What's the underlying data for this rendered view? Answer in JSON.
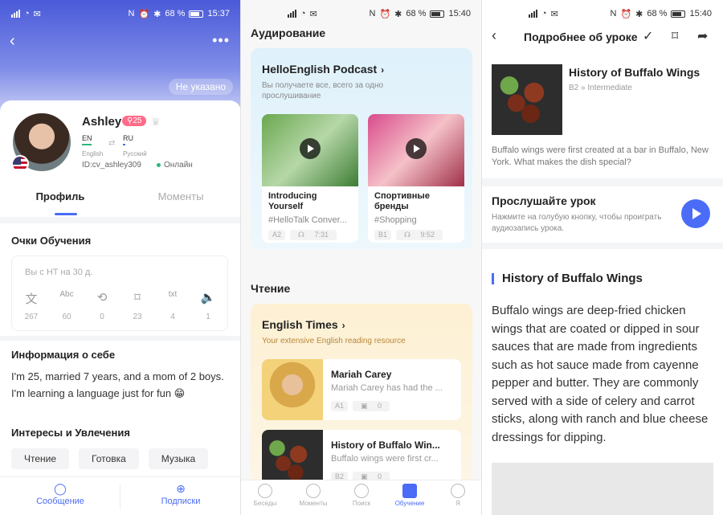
{
  "status_bars": [
    {
      "battery": "68 %",
      "time": "15:37"
    },
    {
      "battery": "68 %",
      "time": "15:40"
    },
    {
      "battery": "68 %",
      "time": "15:40"
    }
  ],
  "profile": {
    "not_specified": "Не указано",
    "name": "Ashley",
    "level": "25",
    "native_lang": {
      "code": "EN",
      "name": "English"
    },
    "learning_lang": {
      "code": "RU",
      "name": "Русский"
    },
    "user_id": "ID:cv_ashley309",
    "online": "Онлайн",
    "tabs": [
      "Профиль",
      "Моменты"
    ],
    "points": {
      "title": "Очки Обучения",
      "hint": "Вы с HT на 30 д.",
      "stats": [
        {
          "icon": "translate-icon",
          "glyph": "文",
          "value": "267"
        },
        {
          "icon": "correct-icon",
          "glyph": "Abc",
          "value": "60"
        },
        {
          "icon": "repeat-icon",
          "glyph": "⟲",
          "value": "0"
        },
        {
          "icon": "bookmark-icon",
          "glyph": "⌑",
          "value": "23"
        },
        {
          "icon": "transcribe-icon",
          "glyph": "txt",
          "value": "4"
        },
        {
          "icon": "speaker-icon",
          "glyph": "🔈",
          "value": "1"
        }
      ]
    },
    "about": {
      "title": "Информация о себе",
      "text": "I'm 25, married 7 years, and a mom of 2 boys. I'm learning a language just for fun 😁"
    },
    "interests": {
      "title": "Интересы и Увлечения",
      "items": [
        "Чтение",
        "Готовка",
        "Музыка"
      ]
    },
    "bottom": {
      "message": "Сообщение",
      "follow": "Подписки"
    }
  },
  "learn": {
    "listening_title": "Аудирование",
    "podcast": {
      "title": "HelloEnglish Podcast",
      "subtitle": "Вы получаете все, всего за одно прослушивание",
      "cards": [
        {
          "title": "Introducing Yourself",
          "tag": "#HelloTalk Conver...",
          "level": "A2",
          "duration": "7:31"
        },
        {
          "title": "Спортивные бренды",
          "tag": "#Shopping",
          "level": "B1",
          "duration": "9:52"
        }
      ]
    },
    "reading_title": "Чтение",
    "times": {
      "title": "English Times",
      "subtitle": "Your extensive English reading resource",
      "cards": [
        {
          "title": "Mariah Carey",
          "desc": "Mariah Carey has had the ...",
          "level": "A1",
          "count": "0"
        },
        {
          "title": "History of Buffalo Win...",
          "desc": "Buffalo wings were first cr...",
          "level": "B2",
          "count": "0"
        }
      ]
    },
    "nav": [
      {
        "label": "Беседы",
        "icon": "chats-icon",
        "active": false
      },
      {
        "label": "Моменты",
        "icon": "moments-icon",
        "active": false
      },
      {
        "label": "Поиск",
        "icon": "search-icon",
        "active": false
      },
      {
        "label": "Обучение",
        "icon": "learn-icon",
        "active": true
      },
      {
        "label": "Я",
        "icon": "me-icon",
        "active": false
      }
    ]
  },
  "lesson": {
    "header": "Подробнее об уроке",
    "title": "History of Buffalo Wings",
    "level": "B2 » Intermediate",
    "desc": "Buffalo wings were first created at a bar in Buffalo, New York. What makes the dish special?",
    "listen_title": "Прослушайте урок",
    "listen_desc": "Нажмите на голубую кнопку, чтобы проиграть аудиозапись урока.",
    "article_title": "History of Buffalo Wings",
    "article_body": "Buffalo wings are deep-fried chicken wings that are coated or dipped in sour sauces that are made from ingredients such as hot sauce made from cayenne pepper and butter. They are commonly served with a side of celery and carrot sticks, along with ranch and blue cheese dressings for dipping."
  }
}
